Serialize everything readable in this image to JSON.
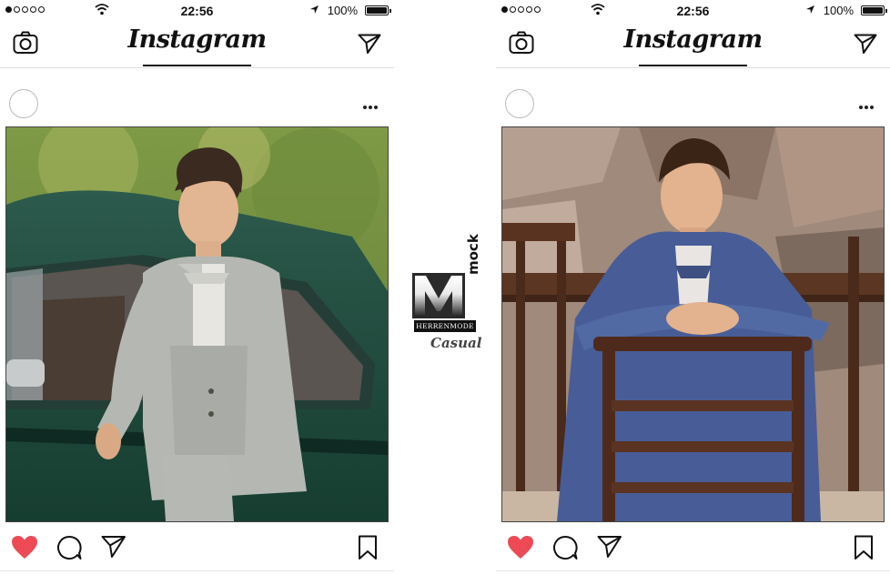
{
  "phones": [
    {
      "status": {
        "time": "22:56",
        "battery": "100%"
      },
      "app_title": "Instagram",
      "photo_subject": "boy-grey-suit-green-car"
    },
    {
      "status": {
        "time": "22:56",
        "battery": "100%"
      },
      "app_title": "Instagram",
      "photo_subject": "boy-blue-suit-wooden-chair"
    }
  ],
  "brand": {
    "name": "mock",
    "tagline": "HERRENMODE",
    "subline": "Casual"
  },
  "icons": [
    "camera-icon",
    "direct-icon",
    "more-icon",
    "heart-icon",
    "comment-icon",
    "share-icon",
    "bookmark-icon",
    "wifi-icon",
    "location-icon",
    "battery-icon"
  ],
  "colors": {
    "heart": "#ed4956",
    "text": "#111111",
    "divider": "#dcdcdc"
  }
}
